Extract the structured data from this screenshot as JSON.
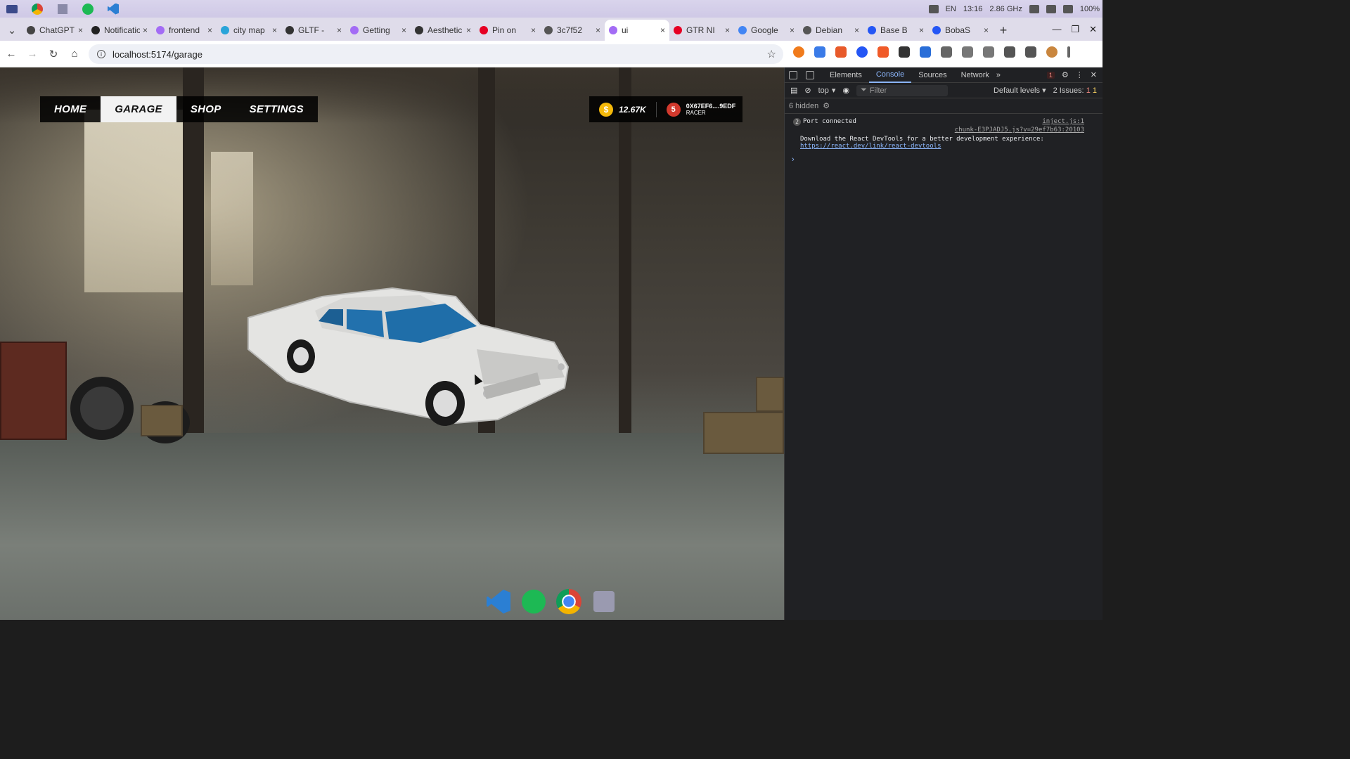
{
  "os": {
    "clock": "13:16",
    "cpu": "2.86 GHz",
    "lang": "EN",
    "battery": "100%"
  },
  "tabs": [
    {
      "label": "ChatGPT",
      "color": "#444"
    },
    {
      "label": "Notifications",
      "color": "#222"
    },
    {
      "label": "frontend",
      "color": "#a36cf5"
    },
    {
      "label": "city map",
      "color": "#29a4d9"
    },
    {
      "label": "GLTF -",
      "color": "#333"
    },
    {
      "label": "Getting",
      "color": "#a36cf5"
    },
    {
      "label": "Aesthetic",
      "color": "#333"
    },
    {
      "label": "Pin on",
      "color": "#e60023"
    },
    {
      "label": "3c7f52",
      "color": "#555"
    },
    {
      "label": "ui",
      "color": "#a36cf5"
    },
    {
      "label": "GTR NI",
      "color": "#e60023"
    },
    {
      "label": "Google",
      "color": "#4285f4"
    },
    {
      "label": "Debian",
      "color": "#555"
    },
    {
      "label": "Base B",
      "color": "#2456f5"
    },
    {
      "label": "BobaS",
      "color": "#2456f5"
    }
  ],
  "active_tab": 9,
  "address": "localhost:5174/garage",
  "game": {
    "nav": [
      "HOME",
      "GARAGE",
      "SHOP",
      "SETTINGS"
    ],
    "active_nav": "GARAGE",
    "coins": "12.67K",
    "level": "5",
    "wallet": "0X67EF6....9EDF",
    "rank": "RACER"
  },
  "devtools": {
    "tabs": [
      "Elements",
      "Console",
      "Sources",
      "Network"
    ],
    "active_tab": "Console",
    "error_count": "1",
    "context": "top",
    "filter_placeholder": "Filter",
    "levels": "Default levels",
    "issues_label": "2 Issues:",
    "issues_red": "1",
    "issues_orange": "1",
    "hidden": "6 hidden",
    "logs": [
      {
        "message": "Port connected",
        "source": "inject.js:1",
        "count": "2"
      },
      {
        "message": "Download the React DevTools for a better development experience:",
        "source": "chunk-E3PJADJ5.js?v=29ef7b63:20103",
        "link": "https://react.dev/link/react-devtools"
      }
    ]
  },
  "dock": [
    "vscode",
    "spotify",
    "chrome",
    "tool"
  ]
}
